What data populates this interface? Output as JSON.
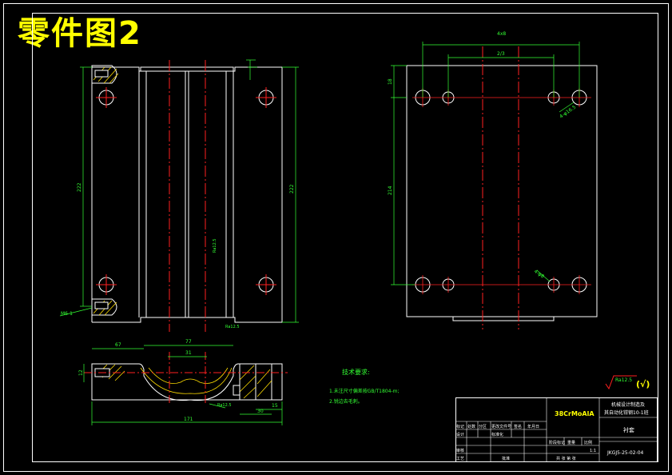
{
  "page_title": "零件图2",
  "material": "38CrMoAlA",
  "title_block": {
    "project_line1": "机械设计制造及",
    "project_line2": "其自动化钳钢10-1班",
    "part_name": "衬套",
    "drawing_no": "JKGJ5-25-02-04",
    "scale": "1:1",
    "sheets": "共 张 第 张",
    "header_cells": [
      "标记",
      "处数",
      "分区",
      "更改文件号",
      "签名",
      "年月日"
    ],
    "row_design": "设计",
    "row_standard": "标准化",
    "row_review": "审核",
    "row_process": "工艺",
    "row_approve": "批准",
    "stage_label": "阶段标记",
    "weight_label": "重量",
    "scale_label": "比例"
  },
  "tech_requirements": {
    "title": "技术要求:",
    "items": [
      "1.未注尺寸偏差按GB/T1804-m;",
      "2.锐边去毛刺。"
    ]
  },
  "roughness_symbol": "Ra12.5",
  "roughness_bracket": "(√)",
  "dimensions": {
    "top_total": "4x8",
    "top_inner": "2/3",
    "front_height": "222",
    "front_height_right": "222",
    "side_height": "214",
    "side_offset": "18",
    "bottom_67": "67",
    "bottom_77": "77",
    "bottom_31": "31",
    "bottom_171": "171",
    "bottom_30": "30",
    "bottom_15": "15",
    "bottom_12": "12",
    "hole_label": "4-φ16.5",
    "hole_label2": "4-φ8",
    "m6": "M6-1",
    "ra_label": "Ra12.5"
  }
}
